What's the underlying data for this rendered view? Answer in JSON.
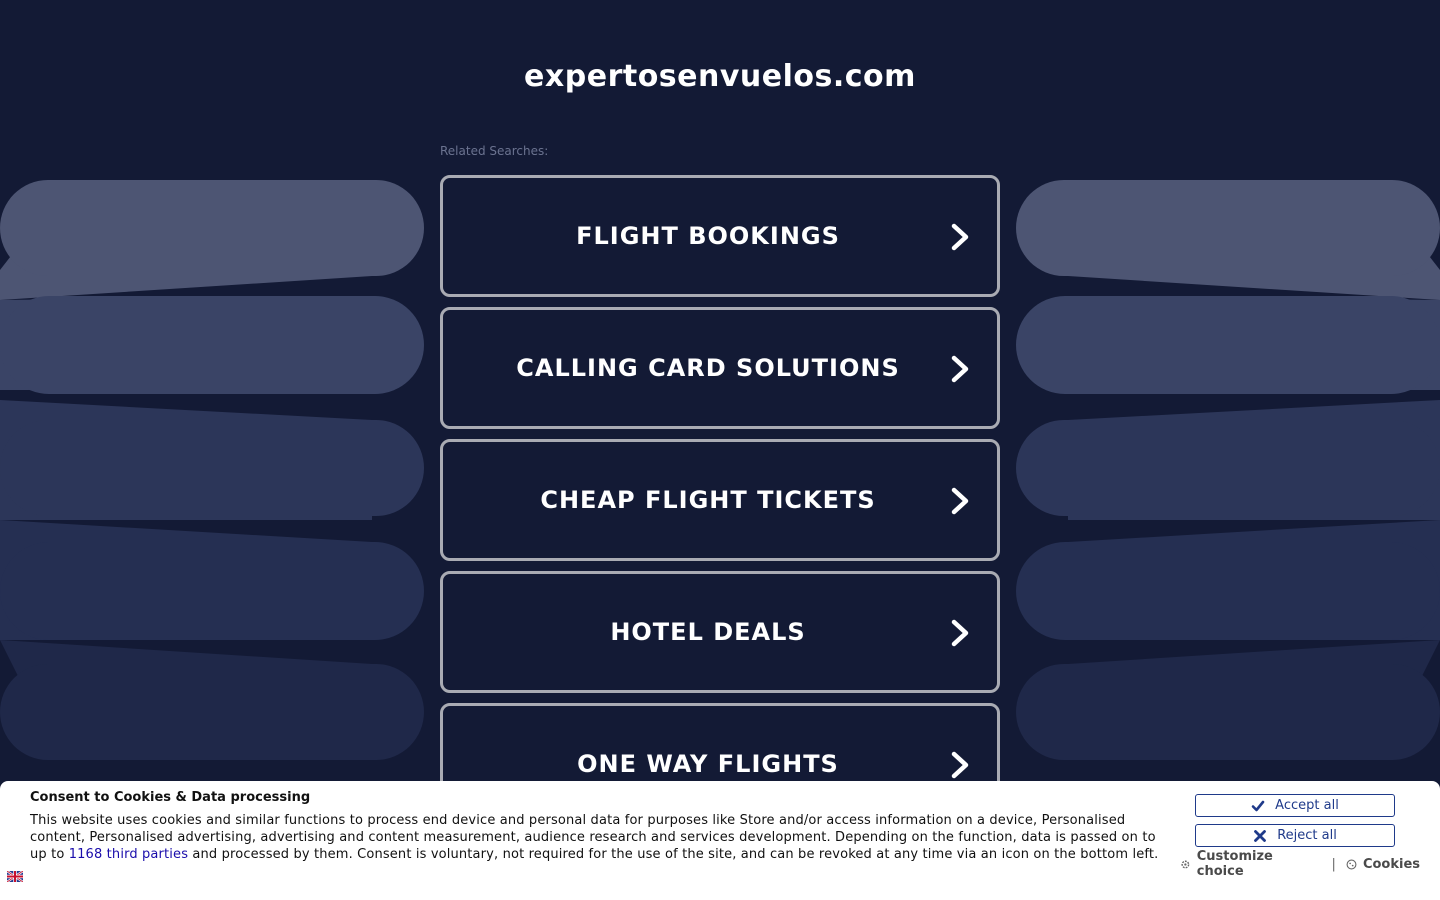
{
  "site": {
    "domain": "expertosenvuelos.com",
    "related_label": "Related Searches:"
  },
  "searches": [
    {
      "label": "FLIGHT BOOKINGS"
    },
    {
      "label": "CALLING CARD SOLUTIONS"
    },
    {
      "label": "CHEAP FLIGHT TICKETS"
    },
    {
      "label": "HOTEL DEALS"
    },
    {
      "label": "ONE WAY FLIGHTS"
    }
  ],
  "consent": {
    "title": "Consent to Cookies & Data processing",
    "text_before": "This website uses cookies and similar functions to process end device and personal data for purposes like Store and/or access information on a device, Personalised content, Personalised advertising, advertising and content measurement, audience research and services development. Depending on the function, data is passed on to up to ",
    "third_parties_link": "1168 third parties",
    "text_after": " and processed by them. Consent is voluntary, not required for the use of the site, and can be revoked at any time via an icon on the bottom left.",
    "accept_label": "Accept all",
    "reject_label": "Reject all",
    "customize_label": "Customize choice",
    "separator": "|",
    "cookies_label": "Cookies"
  },
  "colors": {
    "background": "#131a35",
    "accent": "#1f3a8a",
    "button_border": "#a9abb3"
  },
  "icons": {
    "chevron": "chevron-right-icon",
    "accept": "check-icon",
    "reject": "x-icon",
    "customize": "gear-icon",
    "cookies": "cookie-icon",
    "language": "uk-flag-icon"
  }
}
